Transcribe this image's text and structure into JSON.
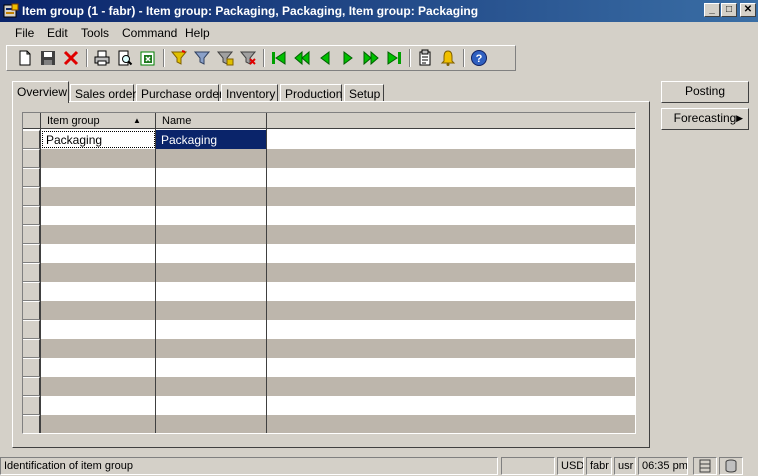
{
  "window": {
    "title": "Item group (1 - fabr) - Item group: Packaging, Packaging, Item group: Packaging",
    "minimize": "_",
    "maximize": "□",
    "close": "✕"
  },
  "menu": [
    "File",
    "Edit",
    "Tools",
    "Command",
    "Help"
  ],
  "toolbar": {
    "icons": [
      "new-icon",
      "save-icon",
      "delete-icon",
      "print-icon",
      "print-preview-icon",
      "export-excel-icon",
      "filter-by-selection-icon",
      "filter-by-grid-icon",
      "advanced-filter-icon",
      "remove-filter-icon",
      "first-record-icon",
      "previous-page-icon",
      "previous-record-icon",
      "next-record-icon",
      "next-page-icon",
      "last-record-icon",
      "document-handling-icon",
      "alert-icon",
      "help-icon"
    ]
  },
  "tabs": [
    "Overview",
    "Sales order",
    "Purchase order",
    "Inventory",
    "Production",
    "Setup"
  ],
  "active_tab": "Overview",
  "grid": {
    "columns": [
      "Item group",
      "Name"
    ],
    "sort_indicator": "▲",
    "rows": [
      {
        "item_group": "Packaging",
        "name": "Packaging"
      }
    ]
  },
  "side_buttons": {
    "posting": "Posting",
    "forecasting": "Forecasting",
    "forecasting_arrow": "▶"
  },
  "status": {
    "message": "Identification of item group",
    "currency": "USD",
    "company": "fabr",
    "user": "usr",
    "time": "06:35 pm"
  }
}
